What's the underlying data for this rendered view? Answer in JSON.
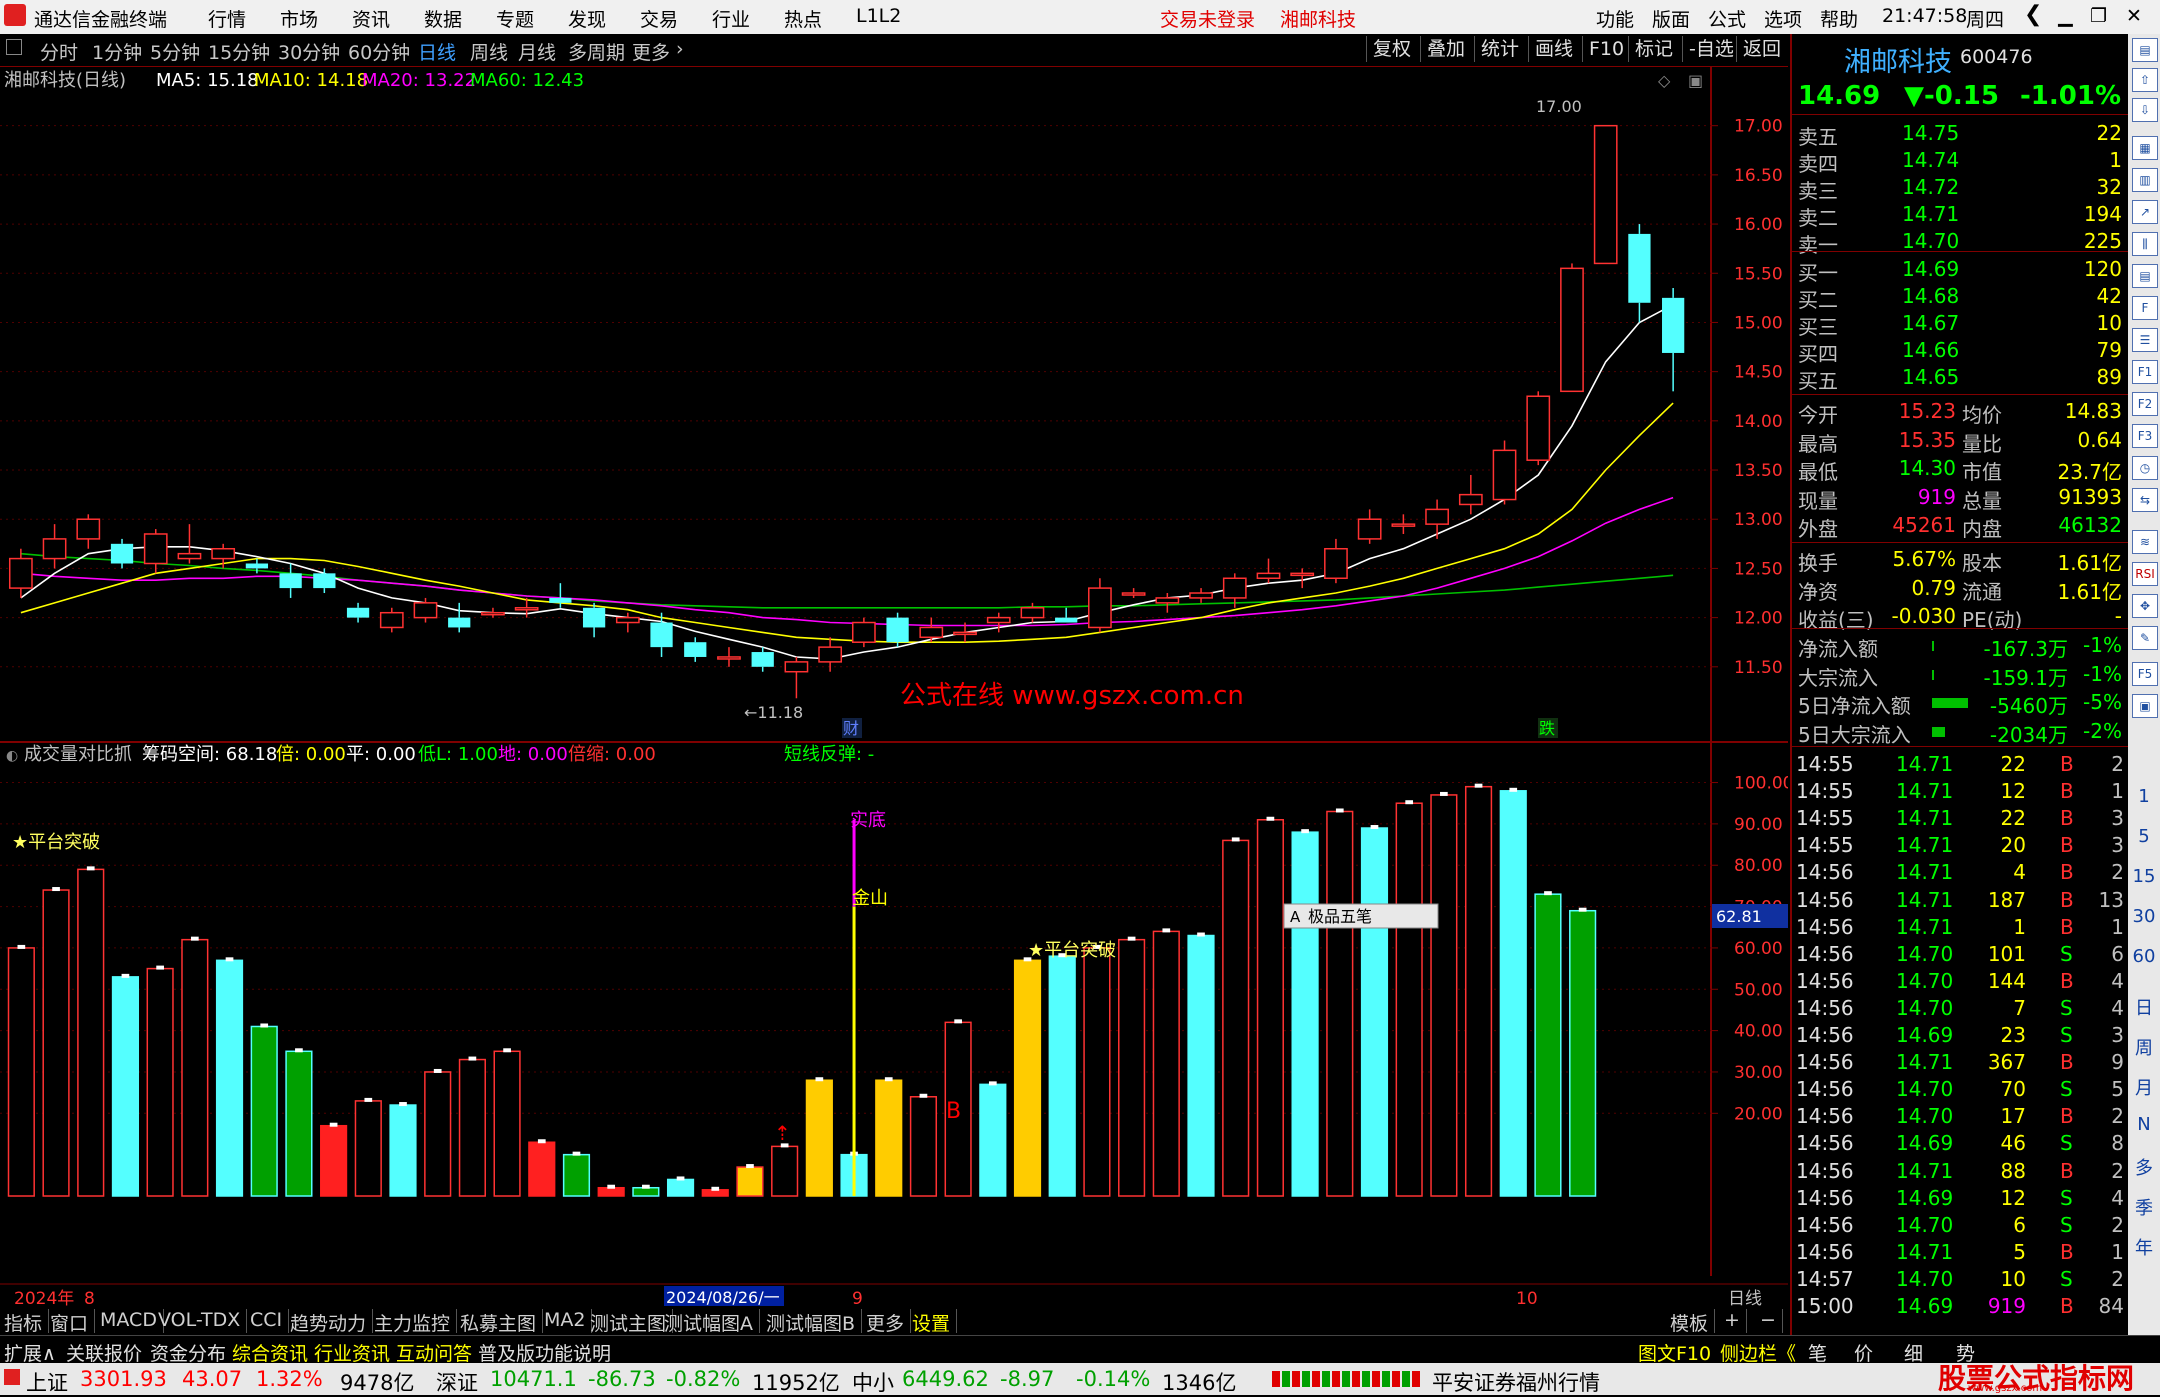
{
  "app": {
    "title": "通达信金融终端",
    "menu": [
      "行情",
      "市场",
      "资讯",
      "数据",
      "专题",
      "发现",
      "交易",
      "行业",
      "热点",
      "L1L2"
    ],
    "trade_status": "交易未登录",
    "stock_name_top": "湘邮科技",
    "right_menu": [
      "功能",
      "版面",
      "公式",
      "选项",
      "帮助"
    ],
    "clock": "21:47:58",
    "weekday": "周四"
  },
  "timeframes": [
    "分时",
    "1分钟",
    "5分钟",
    "15分钟",
    "30分钟",
    "60分钟",
    "日线",
    "周线",
    "月线",
    "多周期",
    "更多"
  ],
  "active_timeframe": "日线",
  "right_buttons": [
    "复权",
    "叠加",
    "统计",
    "画线",
    "F10",
    "标记",
    "-自选",
    "返回"
  ],
  "main_chart": {
    "title": "湘邮科技(日线)",
    "ma": [
      {
        "label": "MA5: 15.18",
        "color": "#ffffff"
      },
      {
        "label": "MA10: 14.18",
        "color": "#ffff00"
      },
      {
        "label": "MA20: 13.22",
        "color": "#ff00ff"
      },
      {
        "label": "MA60: 12.43",
        "color": "#00ff00"
      }
    ],
    "high_label": "17.00",
    "low_label": "←11.18",
    "watermark": "公式在线 www.gszx.com.cn",
    "event_cai": "财",
    "event_die": "跌",
    "y_ticks": [
      "17.00",
      "16.50",
      "16.00",
      "15.50",
      "15.00",
      "14.50",
      "14.00",
      "13.50",
      "13.00",
      "12.50",
      "12.00",
      "11.50"
    ]
  },
  "sub_chart": {
    "indicator": "成交量对比抓",
    "params": [
      {
        "label": "筹码空间: 68.18",
        "color": "#ffffff"
      },
      {
        "label": "倍: 0.00",
        "color": "#ffff00"
      },
      {
        "label": "平: 0.00",
        "color": "#ffffff"
      },
      {
        "label": "低L: 1.00",
        "color": "#00ff00"
      },
      {
        "label": "地: 0.00",
        "color": "#ff00ff"
      },
      {
        "label": "倍缩: 0.00",
        "color": "#ff3030"
      }
    ],
    "short_rebound": "短线反弹: -",
    "labels": {
      "platform1": "★平台突破",
      "platform2": "★平台突破",
      "shidi": "实底",
      "jinshan": "金山",
      "b": "B"
    },
    "y_ticks": [
      "100.00",
      "90.00",
      "80.00",
      "70.00",
      "60.00",
      "50.00",
      "40.00",
      "30.00",
      "20.00"
    ],
    "current_value": "62.81",
    "popup": "极品五笔"
  },
  "xaxis": {
    "year": "2024年",
    "m8": "8",
    "date_box": "2024/08/26/一",
    "m9": "9",
    "m10": "10",
    "period": "日线"
  },
  "chart_data": {
    "type": "candlestick",
    "ylim": [
      11.0,
      17.2
    ],
    "candles": [
      [
        12.3,
        12.7,
        12.2,
        12.6
      ],
      [
        12.6,
        12.95,
        12.5,
        12.8
      ],
      [
        12.8,
        13.05,
        12.7,
        13.0
      ],
      [
        12.75,
        12.8,
        12.5,
        12.55
      ],
      [
        12.55,
        12.9,
        12.45,
        12.85
      ],
      [
        12.6,
        12.95,
        12.55,
        12.65
      ],
      [
        12.6,
        12.75,
        12.5,
        12.7
      ],
      [
        12.55,
        12.6,
        12.45,
        12.5
      ],
      [
        12.45,
        12.55,
        12.2,
        12.3
      ],
      [
        12.45,
        12.5,
        12.25,
        12.3
      ],
      [
        12.1,
        12.15,
        11.95,
        12.0
      ],
      [
        11.9,
        12.1,
        11.85,
        12.05
      ],
      [
        12.0,
        12.2,
        11.95,
        12.15
      ],
      [
        12.0,
        12.15,
        11.85,
        11.9
      ],
      [
        12.05,
        12.1,
        12.0,
        12.05
      ],
      [
        12.1,
        12.2,
        12.0,
        12.1
      ],
      [
        12.2,
        12.35,
        12.1,
        12.15
      ],
      [
        12.1,
        12.15,
        11.8,
        11.9
      ],
      [
        11.95,
        12.05,
        11.85,
        12.0
      ],
      [
        11.95,
        12.05,
        11.6,
        11.7
      ],
      [
        11.75,
        11.8,
        11.55,
        11.6
      ],
      [
        11.6,
        11.7,
        11.5,
        11.6
      ],
      [
        11.65,
        11.7,
        11.45,
        11.5
      ],
      [
        11.45,
        11.6,
        11.18,
        11.55
      ],
      [
        11.55,
        11.8,
        11.45,
        11.7
      ],
      [
        11.75,
        12.0,
        11.7,
        11.95
      ],
      [
        12.0,
        12.05,
        11.7,
        11.75
      ],
      [
        11.8,
        12.0,
        11.75,
        11.9
      ],
      [
        11.85,
        11.95,
        11.75,
        11.85
      ],
      [
        11.95,
        12.05,
        11.85,
        12.0
      ],
      [
        12.0,
        12.15,
        11.95,
        12.1
      ],
      [
        12.0,
        12.1,
        11.95,
        11.95
      ],
      [
        11.9,
        12.4,
        11.85,
        12.3
      ],
      [
        12.25,
        12.3,
        12.2,
        12.25
      ],
      [
        12.15,
        12.25,
        12.05,
        12.2
      ],
      [
        12.2,
        12.3,
        12.15,
        12.25
      ],
      [
        12.2,
        12.45,
        12.1,
        12.4
      ],
      [
        12.4,
        12.6,
        12.35,
        12.45
      ],
      [
        12.45,
        12.5,
        12.3,
        12.45
      ],
      [
        12.4,
        12.8,
        12.35,
        12.7
      ],
      [
        12.8,
        13.1,
        12.75,
        13.0
      ],
      [
        12.95,
        13.05,
        12.85,
        12.95
      ],
      [
        12.95,
        13.2,
        12.8,
        13.1
      ],
      [
        13.15,
        13.45,
        13.05,
        13.25
      ],
      [
        13.2,
        13.8,
        13.15,
        13.7
      ],
      [
        13.6,
        14.3,
        13.55,
        14.25
      ],
      [
        14.3,
        15.6,
        14.3,
        15.55
      ],
      [
        15.6,
        17.0,
        15.6,
        17.0
      ],
      [
        15.9,
        16.0,
        15.0,
        15.2
      ],
      [
        15.25,
        15.35,
        14.3,
        14.69
      ]
    ],
    "ma5": [
      12.2,
      12.45,
      12.65,
      12.7,
      12.72,
      12.72,
      12.68,
      12.62,
      12.55,
      12.45,
      12.3,
      12.2,
      12.15,
      12.07,
      12.05,
      12.04,
      12.09,
      12.04,
      12.0,
      11.96,
      11.86,
      11.78,
      11.7,
      11.6,
      11.58,
      11.65,
      11.7,
      11.78,
      11.85,
      11.9,
      11.95,
      11.96,
      12.05,
      12.13,
      12.2,
      12.23,
      12.3,
      12.35,
      12.38,
      12.45,
      12.6,
      12.7,
      12.85,
      13.0,
      13.2,
      13.45,
      13.95,
      14.6,
      15.0,
      15.18
    ],
    "ma10": [
      12.05,
      12.15,
      12.25,
      12.35,
      12.45,
      12.5,
      12.55,
      12.6,
      12.6,
      12.58,
      12.52,
      12.45,
      12.38,
      12.32,
      12.25,
      12.18,
      12.15,
      12.12,
      12.08,
      12.0,
      11.95,
      11.9,
      11.85,
      11.8,
      11.78,
      11.76,
      11.75,
      11.75,
      11.75,
      11.76,
      11.78,
      11.8,
      11.85,
      11.9,
      11.95,
      12.0,
      12.08,
      12.15,
      12.2,
      12.25,
      12.32,
      12.4,
      12.5,
      12.6,
      12.7,
      12.85,
      13.1,
      13.5,
      13.85,
      14.18
    ],
    "ma20": [
      12.45,
      12.42,
      12.4,
      12.38,
      12.38,
      12.4,
      12.4,
      12.42,
      12.42,
      12.4,
      12.38,
      12.35,
      12.32,
      12.28,
      12.25,
      12.22,
      12.2,
      12.18,
      12.15,
      12.12,
      12.08,
      12.05,
      12.0,
      11.98,
      11.95,
      11.94,
      11.93,
      11.92,
      11.92,
      11.92,
      11.92,
      11.93,
      11.95,
      11.96,
      11.98,
      12.0,
      12.02,
      12.05,
      12.08,
      12.12,
      12.17,
      12.22,
      12.3,
      12.4,
      12.5,
      12.62,
      12.78,
      12.96,
      13.1,
      13.22
    ],
    "ma60": [
      12.65,
      12.62,
      12.6,
      12.58,
      12.55,
      12.53,
      12.5,
      12.48,
      12.45,
      12.42,
      12.38,
      12.35,
      12.32,
      12.28,
      12.25,
      12.22,
      12.2,
      12.17,
      12.15,
      12.13,
      12.12,
      12.11,
      12.1,
      12.1,
      12.1,
      12.1,
      12.1,
      12.1,
      12.1,
      12.1,
      12.11,
      12.11,
      12.12,
      12.12,
      12.13,
      12.14,
      12.15,
      12.16,
      12.17,
      12.18,
      12.2,
      12.22,
      12.24,
      12.26,
      12.28,
      12.31,
      12.34,
      12.37,
      12.4,
      12.43
    ],
    "sub_ylim": [
      0,
      104
    ],
    "sub_bars": [
      [
        60,
        "r"
      ],
      [
        74,
        "r"
      ],
      [
        79,
        "r"
      ],
      [
        53,
        "c"
      ],
      [
        55,
        "r"
      ],
      [
        62,
        "r"
      ],
      [
        57,
        "c"
      ],
      [
        41,
        "g"
      ],
      [
        35,
        "g"
      ],
      [
        17,
        "rf"
      ],
      [
        23,
        "r"
      ],
      [
        22,
        "c"
      ],
      [
        30,
        "r"
      ],
      [
        33,
        "r"
      ],
      [
        35,
        "r"
      ],
      [
        13,
        "rf"
      ],
      [
        10,
        "g"
      ],
      [
        2,
        "rf"
      ],
      [
        2,
        "g"
      ],
      [
        4,
        "c"
      ],
      [
        1.5,
        "rf"
      ],
      [
        7,
        "yy"
      ],
      [
        12,
        "r"
      ],
      [
        28,
        "y"
      ],
      [
        10,
        "c"
      ],
      [
        28,
        "y"
      ],
      [
        24,
        "r"
      ],
      [
        42,
        "r"
      ],
      [
        27,
        "c"
      ],
      [
        57,
        "y"
      ],
      [
        58,
        "c"
      ],
      [
        60,
        "r"
      ],
      [
        62,
        "r"
      ],
      [
        64,
        "r"
      ],
      [
        63,
        "c"
      ],
      [
        86,
        "r"
      ],
      [
        91,
        "r"
      ],
      [
        88,
        "c"
      ],
      [
        93,
        "r"
      ],
      [
        89,
        "c"
      ],
      [
        95,
        "r"
      ],
      [
        97,
        "r"
      ],
      [
        99,
        "r"
      ],
      [
        98,
        "c"
      ],
      [
        73,
        "g"
      ],
      [
        69,
        "g"
      ]
    ]
  },
  "quote": {
    "name": "湘邮科技",
    "code": "600476",
    "price": "14.69",
    "change": "▼-0.15",
    "pct": "-1.01%",
    "asks": [
      {
        "label": "卖五",
        "price": "14.75",
        "vol": "22"
      },
      {
        "label": "卖四",
        "price": "14.74",
        "vol": "1"
      },
      {
        "label": "卖三",
        "price": "14.72",
        "vol": "32"
      },
      {
        "label": "卖二",
        "price": "14.71",
        "vol": "194"
      },
      {
        "label": "卖一",
        "price": "14.70",
        "vol": "225"
      }
    ],
    "bids": [
      {
        "label": "买一",
        "price": "14.69",
        "vol": "120"
      },
      {
        "label": "买二",
        "price": "14.68",
        "vol": "42"
      },
      {
        "label": "买三",
        "price": "14.67",
        "vol": "10"
      },
      {
        "label": "买四",
        "price": "14.66",
        "vol": "79"
      },
      {
        "label": "买五",
        "price": "14.65",
        "vol": "89"
      }
    ],
    "stats": [
      {
        "l1": "今开",
        "v1": "15.23",
        "c1": "#ff3030",
        "l2": "均价",
        "v2": "14.83",
        "c2": "#ffff00"
      },
      {
        "l1": "最高",
        "v1": "15.35",
        "c1": "#ff3030",
        "l2": "量比",
        "v2": "0.64",
        "c2": "#ffff00"
      },
      {
        "l1": "最低",
        "v1": "14.30",
        "c1": "#00ff00",
        "l2": "市值",
        "v2": "23.7亿",
        "c2": "#ffff00"
      },
      {
        "l1": "现量",
        "v1": "919",
        "c1": "#ff00ff",
        "l2": "总量",
        "v2": "91393",
        "c2": "#ffff00"
      },
      {
        "l1": "外盘",
        "v1": "45261",
        "c1": "#ff3030",
        "l2": "内盘",
        "v2": "46132",
        "c2": "#00ff00"
      }
    ],
    "stats2": [
      {
        "l1": "换手",
        "v1": "5.67%",
        "l2": "股本",
        "v2": "1.61亿"
      },
      {
        "l1": "净资",
        "v1": "0.79",
        "l2": "流通",
        "v2": "1.61亿"
      },
      {
        "l1": "收益(三)",
        "v1": "-0.030",
        "l2": "PE(动)",
        "v2": "-"
      }
    ],
    "flows": [
      {
        "label": "净流入额",
        "value": "-167.3万",
        "pct": "-1%",
        "bar": 0.0
      },
      {
        "label": "大宗流入",
        "value": "-159.1万",
        "pct": "-1%",
        "bar": 0.0
      },
      {
        "label": "5日净流入额",
        "value": "-5460万",
        "pct": "-5%",
        "bar": 1.0
      },
      {
        "label": "5日大宗流入",
        "value": "-2034万",
        "pct": "-2%",
        "bar": 0.35
      }
    ]
  },
  "ticks": [
    [
      "14:55",
      "14.71",
      "22",
      "B",
      "2"
    ],
    [
      "14:55",
      "14.71",
      "12",
      "B",
      "1"
    ],
    [
      "14:55",
      "14.71",
      "22",
      "B",
      "3"
    ],
    [
      "14:55",
      "14.71",
      "20",
      "B",
      "3"
    ],
    [
      "14:56",
      "14.71",
      "4",
      "B",
      "2"
    ],
    [
      "14:56",
      "14.71",
      "187",
      "B",
      "13"
    ],
    [
      "14:56",
      "14.71",
      "1",
      "B",
      "1"
    ],
    [
      "14:56",
      "14.70",
      "101",
      "S",
      "6"
    ],
    [
      "14:56",
      "14.70",
      "144",
      "B",
      "4"
    ],
    [
      "14:56",
      "14.70",
      "7",
      "S",
      "4"
    ],
    [
      "14:56",
      "14.69",
      "23",
      "S",
      "3"
    ],
    [
      "14:56",
      "14.71",
      "367",
      "B",
      "9"
    ],
    [
      "14:56",
      "14.70",
      "70",
      "S",
      "5"
    ],
    [
      "14:56",
      "14.70",
      "17",
      "B",
      "2"
    ],
    [
      "14:56",
      "14.69",
      "46",
      "S",
      "8"
    ],
    [
      "14:56",
      "14.71",
      "88",
      "B",
      "2"
    ],
    [
      "14:56",
      "14.69",
      "12",
      "S",
      "4"
    ],
    [
      "14:56",
      "14.70",
      "6",
      "S",
      "2"
    ],
    [
      "14:56",
      "14.71",
      "5",
      "B",
      "1"
    ],
    [
      "14:57",
      "14.70",
      "10",
      "S",
      "2"
    ],
    [
      "15:00",
      "14.69",
      "919",
      "B",
      "84"
    ]
  ],
  "bottom_tabs": [
    "指标",
    "窗口",
    "MACD",
    "VOL-TDX",
    "CCI",
    "趋势动力",
    "主力监控",
    "私募主图",
    "MA2",
    "测试主图",
    "测试幅图A",
    "测试幅图B",
    "更多",
    "设置"
  ],
  "bottom_right": "模板",
  "ext_tabs": [
    "扩展∧",
    "关联报价",
    "资金分布",
    "综合资讯",
    "行业资讯",
    "互动问答",
    "普及版功能说明"
  ],
  "ext_right": [
    "图文F10",
    "侧边栏《",
    "笔",
    "价",
    "细",
    "势"
  ],
  "status": {
    "sh": {
      "name": "上证",
      "val": "3301.93",
      "chg": "43.07",
      "pct": "1.32%",
      "amt": "9478亿"
    },
    "sz": {
      "name": "深证",
      "val": "10471.1",
      "chg": "-86.73",
      "pct": "-0.82%",
      "amt": "11952亿"
    },
    "zx": {
      "name": "中小",
      "val": "6449.62",
      "chg": "-8.97",
      "pct": "-0.14%",
      "amt": "1346亿"
    },
    "broker": "平安证券福州行情",
    "logo": "股票公式指标网",
    "logo_url": "www.gszx.com"
  },
  "strip_labels": [
    "1",
    "5",
    "15",
    "30",
    "60",
    "日",
    "周",
    "月",
    "N",
    "多",
    "季",
    "年"
  ]
}
